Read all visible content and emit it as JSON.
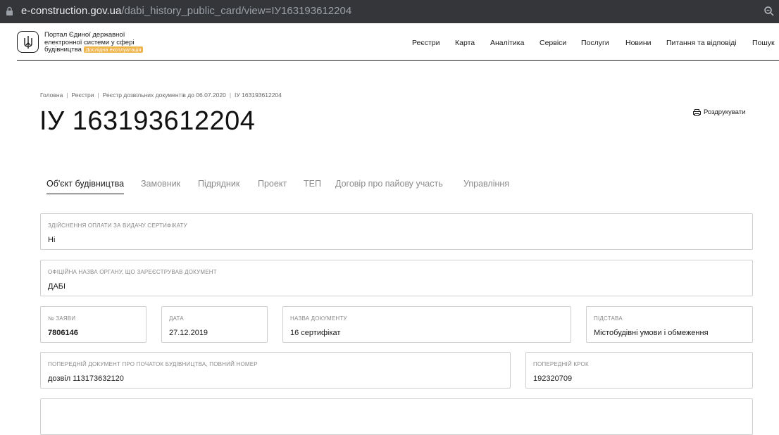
{
  "browser": {
    "url_host": "e-construction.gov.ua",
    "url_path": "/dabi_history_public_card/view=ІУ163193612204"
  },
  "header": {
    "portal_line1": "Портал Єдиної державної",
    "portal_line2": "електронної системи у сфері",
    "portal_line3": "будівництва",
    "badge": "Дослідна експлуатація",
    "nav": [
      "Реєстри",
      "Карта",
      "Аналітика",
      "Сервіси",
      "Послуги",
      "Новини",
      "Питання та відповіді",
      "Пошук"
    ]
  },
  "breadcrumb": [
    "Головна",
    "Реєстри",
    "Реєстр дозвільних документів до 06.07.2020",
    "ІУ 163193612204"
  ],
  "page_title": "ІУ 163193612204",
  "print_label": "Роздрукувати",
  "tabs": [
    "Об'єкт будівництва",
    "Замовник",
    "Підрядник",
    "Проект",
    "ТЕП",
    "Договір про пайову участь",
    "Управління"
  ],
  "fields": {
    "payment": {
      "label": "Здійснення оплати за видачу сертифікату",
      "value": "Ні"
    },
    "authority": {
      "label": "Офіційна назва органу, що зареєстрував документ",
      "value": "ДАБІ"
    },
    "app_no": {
      "label": "№ заяви",
      "value": "7806146"
    },
    "date": {
      "label": "Дата",
      "value": "27.12.2019"
    },
    "doc_name": {
      "label": "Назва документу",
      "value": "16 сертифікат"
    },
    "basis": {
      "label": "Підстава",
      "value": "Містобудівні умови і обмеження"
    },
    "prev_doc": {
      "label": "Попередній документ про початок будівництва, повний номер",
      "value": "дозвіл 113173632120"
    },
    "prev_step": {
      "label": "Попередній крок",
      "value": "192320709"
    }
  }
}
